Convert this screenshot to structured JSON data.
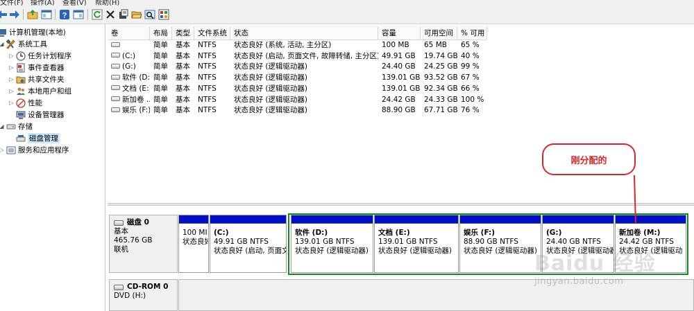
{
  "menubar": {
    "items": [
      "文件(F)",
      "操作(A)",
      "查看(V)",
      "帮助(H)"
    ]
  },
  "toolbar": {
    "buttons": [
      "back-icon",
      "forward-icon",
      "up-folder-icon",
      "show-tree-icon",
      "help-icon",
      "properties-pane-icon",
      "refresh-icon",
      "delete-icon",
      "properties-icon",
      "open-icon",
      "search-icon",
      "settings-icon"
    ]
  },
  "tree": {
    "root": "计算机管理(本地)",
    "system_tools": "系统工具",
    "task_scheduler": "任务计划程序",
    "event_viewer": "事件查看器",
    "shared_folders": "共享文件夹",
    "local_users": "本地用户和组",
    "performance": "性能",
    "device_manager": "设备管理器",
    "storage": "存储",
    "disk_management": "磁盘管理",
    "services_apps": "服务和应用程序"
  },
  "volume_table": {
    "headers": [
      "卷",
      "布局",
      "类型",
      "文件系统",
      "状态",
      "容量",
      "可用空间",
      "% 可用"
    ],
    "rows": [
      [
        "",
        "简单",
        "基本",
        "NTFS",
        "状态良好 (系统, 活动, 主分区)",
        "100 MB",
        "65 MB",
        "65 %"
      ],
      [
        "(C:)",
        "简单",
        "基本",
        "NTFS",
        "状态良好 (启动, 页面文件, 故障转储, 主分区)",
        "49.91 GB",
        "19.74 GB",
        "40 %"
      ],
      [
        "(G:)",
        "简单",
        "基本",
        "NTFS",
        "状态良好 (逻辑驱动器)",
        "24.40 GB",
        "24.25 GB",
        "99 %"
      ],
      [
        "软件 (D:)",
        "简单",
        "基本",
        "NTFS",
        "状态良好 (逻辑驱动器)",
        "139.01 GB",
        "93.52 GB",
        "67 %"
      ],
      [
        "文档 (E:)",
        "简单",
        "基本",
        "NTFS",
        "状态良好 (逻辑驱动器)",
        "139.01 GB",
        "92.34 GB",
        "66 %"
      ],
      [
        "新加卷 ...",
        "简单",
        "基本",
        "NTFS",
        "状态良好 (逻辑驱动器)",
        "24.42 GB",
        "24.33 GB",
        "100 %"
      ],
      [
        "娱乐 (F:)",
        "简单",
        "基本",
        "NTFS",
        "状态良好 (逻辑驱动器)",
        "88.90 GB",
        "67.71 GB",
        "76 %"
      ]
    ]
  },
  "disk0": {
    "title": "磁盘 0",
    "type": "基本",
    "size": "465.76 GB",
    "status": "联机",
    "partitions": [
      {
        "name": "",
        "size": "100 MI",
        "status": "状态良好"
      },
      {
        "name": "(C:)",
        "size": "49.91 GB NTFS",
        "status": "状态良好 (启动, 页面文"
      },
      {
        "name": "软件  (D:)",
        "size": "139.01 GB NTFS",
        "status": "状态良好 (逻辑驱动器)"
      },
      {
        "name": "文档  (E:)",
        "size": "139.01 GB NTFS",
        "status": "状态良好 (逻辑驱动器)"
      },
      {
        "name": "娱乐  (F:)",
        "size": "88.90 GB NTFS",
        "status": "状态良好 (逻辑驱动器)"
      },
      {
        "name": "(G:)",
        "size": "24.40 GB NTFS",
        "status": "状态良好 (逻辑驱动器)"
      },
      {
        "name": "新加卷  (M:)",
        "size": "24.42 GB NTFS",
        "status": "状态良好 (逻辑驱动"
      }
    ]
  },
  "cdrom0": {
    "title": "CD-ROM 0",
    "drive": "DVD (H:)"
  },
  "annotation": {
    "callout": "刚分配的"
  },
  "watermark": {
    "logo": "Baidu 经验",
    "url": "jingyan.baidu.com"
  },
  "colors": {
    "partition_bar": "#0010c8",
    "highlight_box": "#138a1e",
    "callout": "#d9262a"
  }
}
